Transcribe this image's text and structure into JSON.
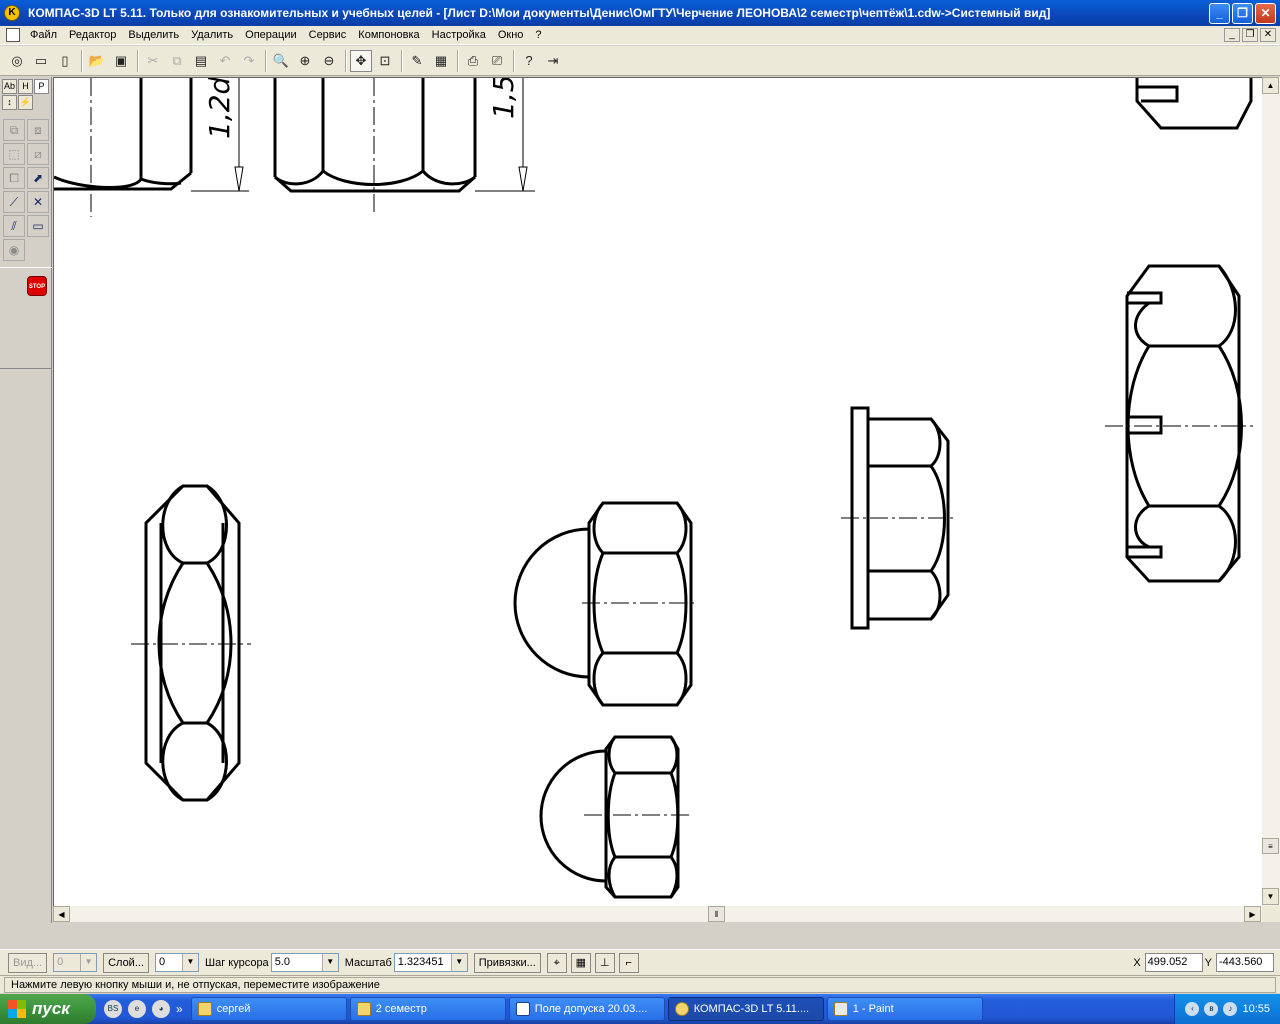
{
  "window": {
    "title": "КОМПАС-3D LT 5.11. Только для ознакомительных и учебных целей - [Лист D:\\Мои документы\\Денис\\ОмГТУ\\Черчение ЛЕОНОВА\\2 семестр\\чептёж\\1.cdw->Системный вид]",
    "minimize_icon": "minimize-icon",
    "maximize_icon": "restore-icon",
    "close_icon": "close-icon"
  },
  "menu": {
    "items": [
      "Файл",
      "Редактор",
      "Выделить",
      "Удалить",
      "Операции",
      "Сервис",
      "Компоновка",
      "Настройка",
      "Окно",
      "?"
    ]
  },
  "toolbar": {
    "icons": [
      "new-drawing-icon",
      "new-sheet-icon",
      "new-document-icon",
      "open-icon",
      "save-icon",
      "cut-icon",
      "copy-icon",
      "paste-icon",
      "undo-icon",
      "redo-icon",
      "zoom-window-icon",
      "zoom-in-icon",
      "zoom-out-icon",
      "pan-icon",
      "zoom-all-icon",
      "refresh-icon",
      "layer-icon",
      "print-preview-icon",
      "print-icon",
      "help-icon",
      "exit-icon"
    ]
  },
  "leftpanel": {
    "tabs": [
      "Аb",
      "H",
      "P"
    ]
  },
  "drawing": {
    "dim_labels": [
      "1,2d",
      "1,5d"
    ]
  },
  "statusbar": {
    "view_label": "Вид...",
    "view_value": "0",
    "layer_label": "Слой...",
    "layer_value": "0",
    "step_label": "Шаг курсора",
    "step_value": "5.0",
    "scale_label": "Масштаб",
    "scale_value": "1.323451",
    "snaps_label": "Привязки...",
    "x_label": "X",
    "x_value": "499.052",
    "y_label": "Y",
    "y_value": "-443.560"
  },
  "hint": "Нажмите левую кнопку мыши и, не отпуская, переместите изображение",
  "taskbar": {
    "start_label": "пуск",
    "quicklaunch": [
      "BS",
      "ie-icon",
      "panda-icon"
    ],
    "more": "»",
    "buttons": [
      {
        "label": "сергей",
        "icon": "folder-icon"
      },
      {
        "label": "2 семестр",
        "icon": "folder-icon"
      },
      {
        "label": "Поле допуска 20.03....",
        "icon": "word-icon"
      },
      {
        "label": "КОМПАС-3D LT 5.11....",
        "icon": "kompas-icon"
      },
      {
        "label": "1 - Paint",
        "icon": "paint-icon"
      }
    ],
    "clock": "10:55"
  }
}
